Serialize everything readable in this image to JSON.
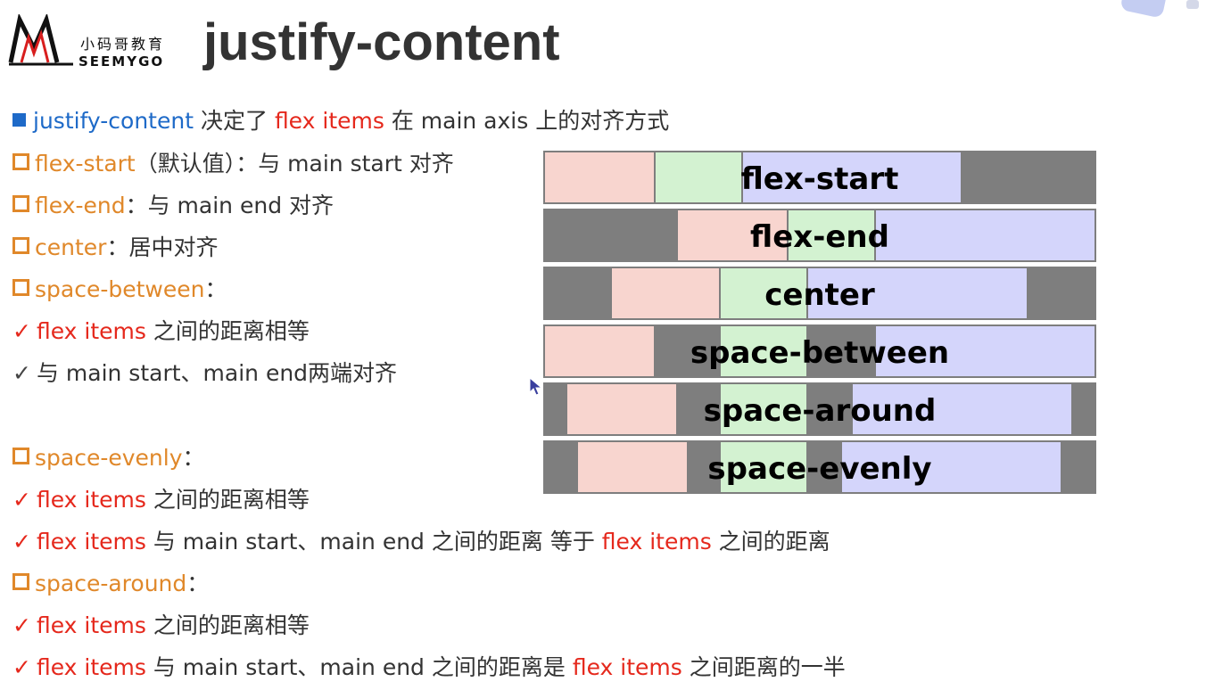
{
  "logo": {
    "cn": "小码哥教育",
    "en": "SEEMYGO"
  },
  "title": "justify-content",
  "intro": {
    "kw": "justify-content",
    "t1": " 决定了 ",
    "kw2": "flex items",
    "t2": " 在 main axis 上的对齐方式"
  },
  "items": [
    {
      "kw": "flex-start",
      "desc": "（默认值）：与 main start 对齐"
    },
    {
      "kw": "flex-end",
      "desc": "：与 main end 对齐"
    },
    {
      "kw": "center",
      "desc": "：居中对齐"
    },
    {
      "kw": "space-between",
      "desc": "："
    }
  ],
  "between_points": [
    {
      "kw": "flex items",
      "rest": " 之间的距离相等"
    },
    {
      "rest": "与 main start、main end两端对齐"
    }
  ],
  "evenly": {
    "kw": "space-evenly",
    "desc": "："
  },
  "evenly_points": [
    {
      "kw": "flex items",
      "rest": " 之间的距离相等"
    },
    {
      "kw": "flex items",
      "rest": " 与 main start、main end 之间的距离 等于 ",
      "kw2": "flex items",
      "rest2": " 之间的距离"
    }
  ],
  "around": {
    "kw": "space-around",
    "desc": "："
  },
  "around_points": [
    {
      "kw": "flex items",
      "rest": " 之间的距离相等"
    },
    {
      "kw": "flex items",
      "rest": " 与 main start、main end 之间的距离是 ",
      "kw2": "flex items",
      "rest2": " 之间距离的一半"
    }
  ],
  "demo_rows": [
    {
      "label": "flex-start"
    },
    {
      "label": "flex-end"
    },
    {
      "label": "center"
    },
    {
      "label": "space-between"
    },
    {
      "label": "space-around"
    },
    {
      "label": "space-evenly"
    }
  ],
  "colors": {
    "keyword_blue": "#1e6ac8",
    "keyword_red": "#e5281c",
    "keyword_orange": "#e0882a",
    "container_gray": "#7e7e7e",
    "item_pink": "#f8d5cf",
    "item_green": "#d3f2d1",
    "item_lavender": "#d4d5fb"
  }
}
